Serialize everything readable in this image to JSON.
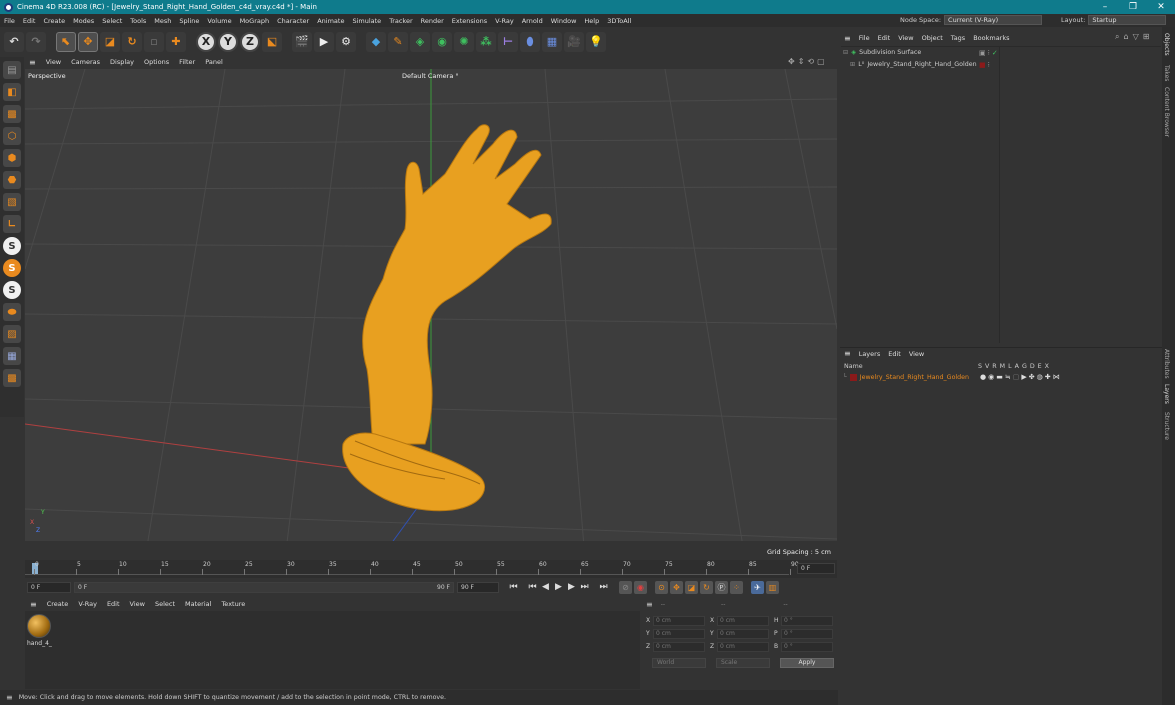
{
  "window": {
    "title": "Cinema 4D R23.008 (RC) - [Jewelry_Stand_Right_Hand_Golden_c4d_vray.c4d *] - Main",
    "controls": [
      "–",
      "❐",
      "✕"
    ]
  },
  "menu": [
    "File",
    "Edit",
    "Create",
    "Modes",
    "Select",
    "Tools",
    "Mesh",
    "Spline",
    "Volume",
    "MoGraph",
    "Character",
    "Animate",
    "Simulate",
    "Tracker",
    "Render",
    "Extensions",
    "V-Ray",
    "Arnold",
    "Window",
    "Help",
    "3DToAll"
  ],
  "node_space": {
    "label": "Node Space:",
    "value": "Current (V-Ray)"
  },
  "layout": {
    "label": "Layout:",
    "value": "Startup"
  },
  "toolbar": {
    "axis_x": "X",
    "axis_y": "Y",
    "axis_z": "Z"
  },
  "left_tools": {
    "s1": "S",
    "s2": "S",
    "s3": "S"
  },
  "viewport": {
    "menu": [
      "View",
      "Cameras",
      "Display",
      "Options",
      "Filter",
      "Panel"
    ],
    "projection": "Perspective",
    "camera": "Default Camera °",
    "grid_spacing": "Grid Spacing : 5 cm",
    "axis_x": "X",
    "axis_y": "Y",
    "axis_z": "Z"
  },
  "timeline": {
    "ticks": [
      "0",
      "5",
      "10",
      "15",
      "20",
      "25",
      "30",
      "35",
      "40",
      "45",
      "50",
      "55",
      "60",
      "65",
      "70",
      "75",
      "80",
      "85",
      "90"
    ],
    "end_field": "0 F"
  },
  "playback": {
    "current": "0 F",
    "start": "0 F",
    "end": "90 F",
    "end2": "90 F"
  },
  "materials": {
    "menu": [
      "Create",
      "V-Ray",
      "Edit",
      "View",
      "Select",
      "Material",
      "Texture"
    ],
    "items": [
      {
        "name": "hand_4_"
      }
    ]
  },
  "coords": {
    "header": [
      "--",
      "--",
      "--"
    ],
    "rows": [
      {
        "a": "X",
        "av": "0 cm",
        "b": "X",
        "bv": "0 cm",
        "c": "H",
        "cv": "0 °"
      },
      {
        "a": "Y",
        "av": "0 cm",
        "b": "Y",
        "bv": "0 cm",
        "c": "P",
        "cv": "0 °"
      },
      {
        "a": "Z",
        "av": "0 cm",
        "b": "Z",
        "bv": "0 cm",
        "c": "B",
        "cv": "0 °"
      }
    ],
    "mode": "World",
    "scale": "Scale",
    "apply": "Apply"
  },
  "status": "Move: Click and drag to move elements. Hold down SHIFT to quantize movement / add to the selection in point mode, CTRL to remove.",
  "objects": {
    "menu": [
      "File",
      "Edit",
      "View",
      "Object",
      "Tags",
      "Bookmarks"
    ],
    "items": [
      {
        "name": "Subdivision Surface"
      },
      {
        "name": "Jewelry_Stand_Right_Hand_Golden"
      }
    ]
  },
  "layers": {
    "menu": [
      "Layers",
      "Edit",
      "View"
    ],
    "header_name": "Name",
    "header_flags": "S V R M L A G D E X",
    "items": [
      {
        "name": "Jewelry_Stand_Right_Hand_Golden",
        "color": "#8b1a1a"
      }
    ]
  },
  "side_tabs": [
    "Objects",
    "Takes",
    "Content Browser",
    "Attributes",
    "Layers",
    "Structure"
  ],
  "colors": {
    "accent": "#e98a1f",
    "title_bar": "#0f7b8c",
    "model": "#e8a020",
    "layer_name": "#e98a1f"
  }
}
